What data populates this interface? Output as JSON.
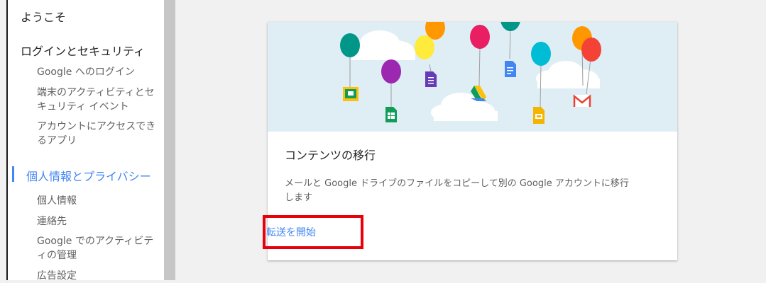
{
  "sidebar": {
    "items": [
      {
        "label": "ようこそ"
      },
      {
        "label": "ログインとセキュリティ"
      },
      {
        "label": "Google へのログイン"
      },
      {
        "label": "端末のアクティビティとセキュリティ イベント"
      },
      {
        "label": "アカウントにアクセスできるアプリ"
      },
      {
        "label": "個人情報とプライバシー",
        "active": true
      },
      {
        "label": "個人情報"
      },
      {
        "label": "連絡先"
      },
      {
        "label": "Google でのアクティビティの管理"
      },
      {
        "label": "広告設定"
      }
    ]
  },
  "card": {
    "title": "コンテンツの移行",
    "description": "メールと Google ドライブのファイルをコピーして別の Google アカウントに移行します",
    "action_label": "転送を開始"
  },
  "colors": {
    "accent": "#4285f4",
    "highlight_border": "#e8000b",
    "illustration_bg": "#dfeef5"
  },
  "illustration": {
    "icons": [
      "classroom-icon",
      "sheets-icon",
      "forms-icon",
      "drive-icon",
      "docs-icon",
      "slides-icon",
      "gmail-icon"
    ]
  }
}
